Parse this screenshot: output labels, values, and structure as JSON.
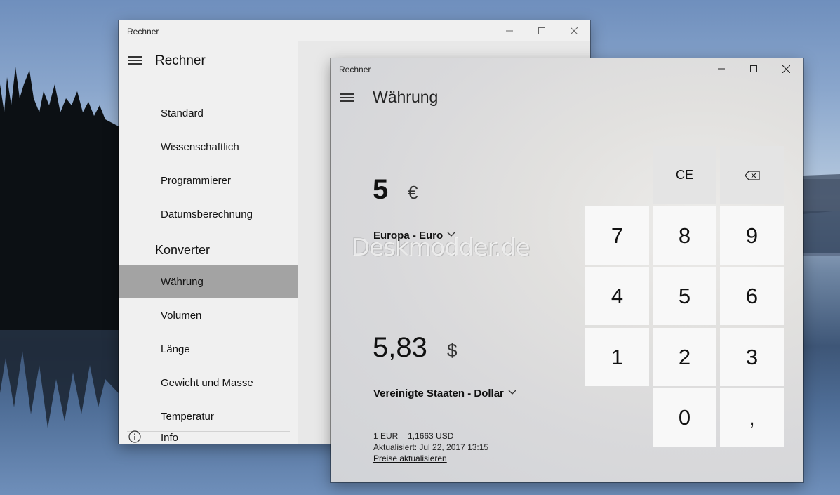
{
  "back_window": {
    "title": "Rechner",
    "nav": {
      "header_calc": "Rechner",
      "calc_items": [
        "Standard",
        "Wissenschaftlich",
        "Programmierer",
        "Datumsberechnung"
      ],
      "header_conv": "Konverter",
      "conv_items": [
        "Währung",
        "Volumen",
        "Länge",
        "Gewicht und Masse",
        "Temperatur"
      ],
      "selected": "Währung",
      "info": "Info"
    }
  },
  "front_window": {
    "title": "Rechner",
    "mode": "Währung",
    "from": {
      "value": "5",
      "symbol": "€",
      "currency": "Europa - Euro"
    },
    "to": {
      "value": "5,83",
      "symbol": "$",
      "currency": "Vereinigte Staaten - Dollar"
    },
    "rate": "1 EUR = 1,1663 USD",
    "updated": "Aktualisiert: Jul 22, 2017 13:15",
    "update_link": "Preise aktualisieren",
    "keys": {
      "ce": "CE",
      "backspace_icon": "backspace-icon",
      "k7": "7",
      "k8": "8",
      "k9": "9",
      "k4": "4",
      "k5": "5",
      "k6": "6",
      "k1": "1",
      "k2": "2",
      "k3": "3",
      "k0": "0",
      "comma": ","
    }
  },
  "watermark": "Deskmodder.de",
  "colors": {
    "nav_selected": "#a3a3a3",
    "key_bg": "#f8f8f8",
    "fn_key_bg": "#e4e4e4"
  }
}
